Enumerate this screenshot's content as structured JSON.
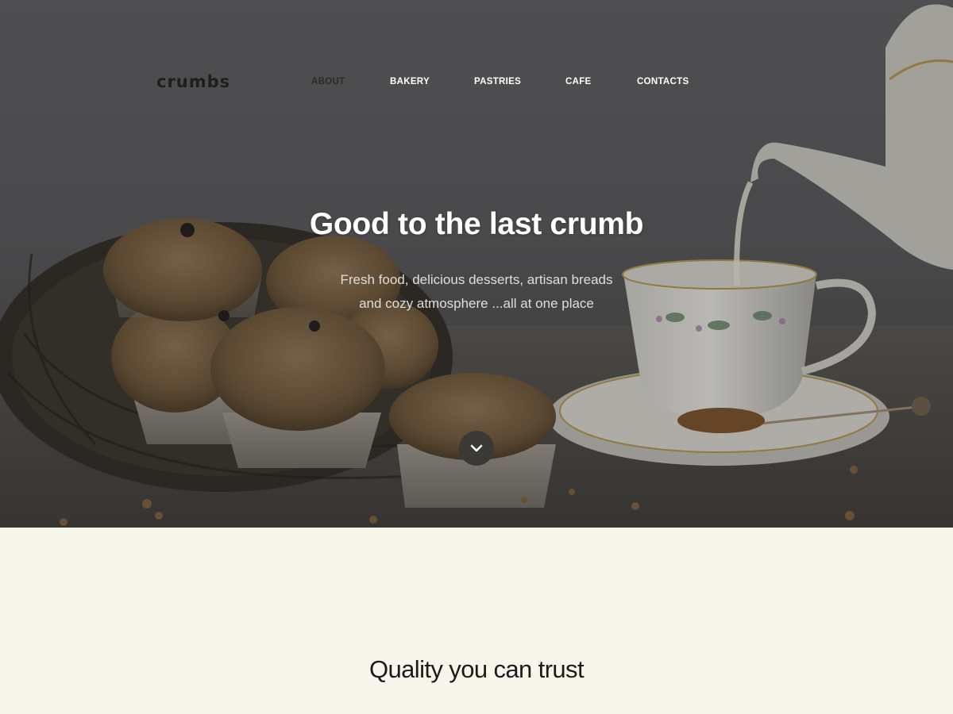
{
  "brand": {
    "logo_text": "crumbs"
  },
  "nav": {
    "items": [
      {
        "label": "ABOUT",
        "active": true
      },
      {
        "label": "BAKERY",
        "active": false
      },
      {
        "label": "PASTRIES",
        "active": false
      },
      {
        "label": "CAFE",
        "active": false
      },
      {
        "label": "CONTACTS",
        "active": false
      }
    ]
  },
  "hero": {
    "title": "Good to the last crumb",
    "subtitle_line1": "Fresh food, delicious desserts, artisan breads",
    "subtitle_line2": "and cozy atmosphere ...all at one place",
    "scroll_icon": "chevron-down-icon"
  },
  "section": {
    "title": "Quality you can trust"
  },
  "colors": {
    "hero_overlay": "#545457",
    "page_background": "#f8f5ea",
    "nav_active": "#2b2b2b",
    "nav_text": "#ffffff",
    "scroll_button": "#3a3936"
  }
}
